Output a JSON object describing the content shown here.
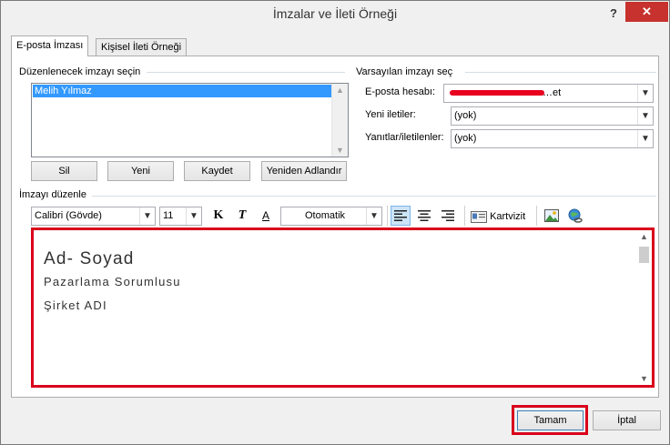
{
  "window": {
    "title": "İmzalar ve İleti Örneği",
    "help_glyph": "?",
    "close_glyph": "✕"
  },
  "tabs": [
    {
      "label": "E-posta İmzası",
      "active": true
    },
    {
      "label": "Kişisel İleti Örneği",
      "active": false
    }
  ],
  "select_section": {
    "label": "Düzenlenecek imzayı seçin",
    "items": [
      "Melih Yılmaz"
    ],
    "buttons": {
      "delete": "Sil",
      "new": "Yeni",
      "save": "Kaydet",
      "rename": "Yeniden Adlandır"
    }
  },
  "default_section": {
    "label": "Varsayılan imzayı seç",
    "account_label": "E-posta hesabı:",
    "account_value": "…et",
    "new_messages_label": "Yeni iletiler:",
    "new_messages_value": "(yok)",
    "replies_label": "Yanıtlar/iletilenler:",
    "replies_value": "(yok)"
  },
  "edit_section": {
    "label": "İmzayı düzenle",
    "font": "Calibri (Gövde)",
    "size": "11",
    "bold": "K",
    "italic": "T",
    "underline": "A",
    "color": "Otomatik",
    "business_card": "Kartvizit"
  },
  "signature": {
    "line1": "Ad- Soyad",
    "line2": "Pazarlama Sorumlusu",
    "line3": "Şirket ADI"
  },
  "footer": {
    "ok": "Tamam",
    "cancel": "İptal"
  },
  "colors": {
    "highlight": "#d9001b",
    "selection": "#3399ff",
    "close": "#c7322e"
  }
}
